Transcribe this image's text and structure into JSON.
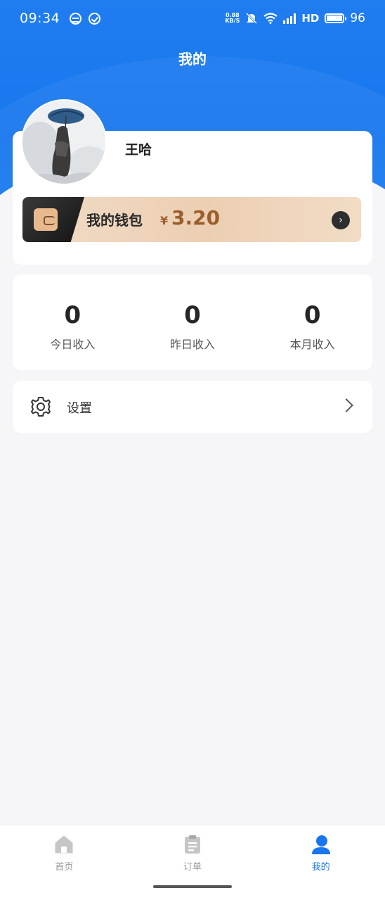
{
  "status_bar": {
    "time": "09:34",
    "net_speed_top": "0.88",
    "net_speed_bottom": "KB/S",
    "network_label": "HD",
    "battery_level": "96"
  },
  "header": {
    "title": "我的"
  },
  "profile": {
    "username": "王哈",
    "wallet_label": "我的钱包",
    "wallet_currency": "¥",
    "wallet_amount": "3.20"
  },
  "income": [
    {
      "value": "0",
      "label": "今日收入"
    },
    {
      "value": "0",
      "label": "昨日收入"
    },
    {
      "value": "0",
      "label": "本月收入"
    }
  ],
  "settings": {
    "label": "设置"
  },
  "tabbar": {
    "items": [
      {
        "label": "首页",
        "icon": "home-icon",
        "active": false
      },
      {
        "label": "订单",
        "icon": "clipboard-icon",
        "active": false
      },
      {
        "label": "我的",
        "icon": "user-icon",
        "active": true
      }
    ]
  },
  "colors": {
    "primary": "#1a76ee",
    "wallet_gold": "#9b5f2c",
    "background": "#f6f6f8"
  }
}
